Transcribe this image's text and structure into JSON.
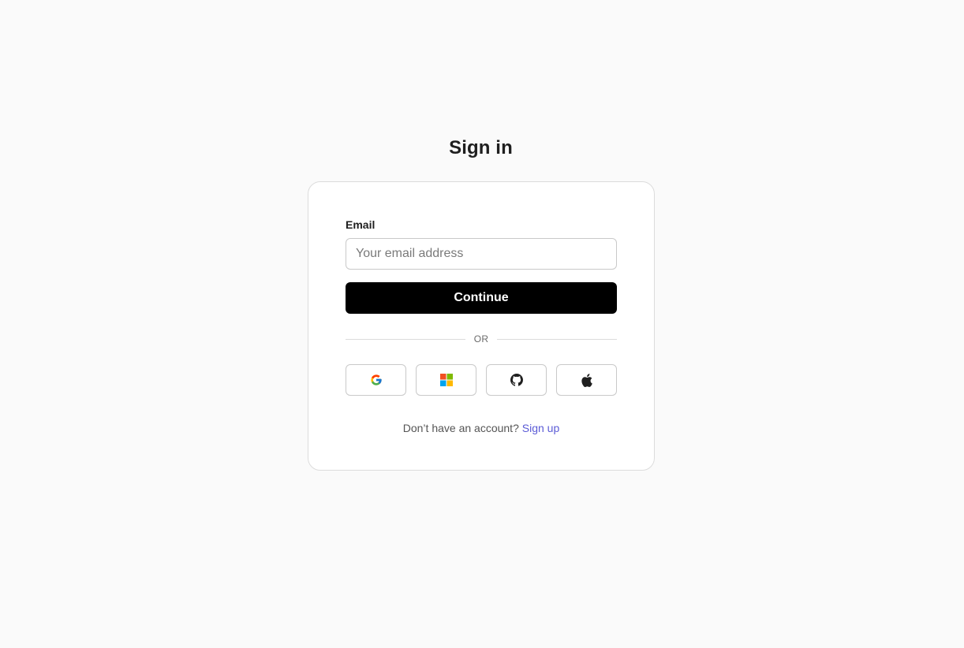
{
  "page": {
    "title": "Sign in"
  },
  "form": {
    "email_label": "Email",
    "email_placeholder": "Your email address",
    "email_value": "",
    "continue_label": "Continue",
    "divider_text": "OR"
  },
  "social": [
    {
      "provider": "Google",
      "icon": "google-icon"
    },
    {
      "provider": "Microsoft",
      "icon": "microsoft-icon"
    },
    {
      "provider": "GitHub",
      "icon": "github-icon"
    },
    {
      "provider": "Apple",
      "icon": "apple-icon"
    }
  ],
  "footer": {
    "prompt": "Don’t have an account?",
    "signup_link": "Sign up"
  },
  "colors": {
    "background": "#fafafa",
    "primary_button": "#000000",
    "link": "#5b5bd6",
    "border": "#c9c9c9"
  }
}
